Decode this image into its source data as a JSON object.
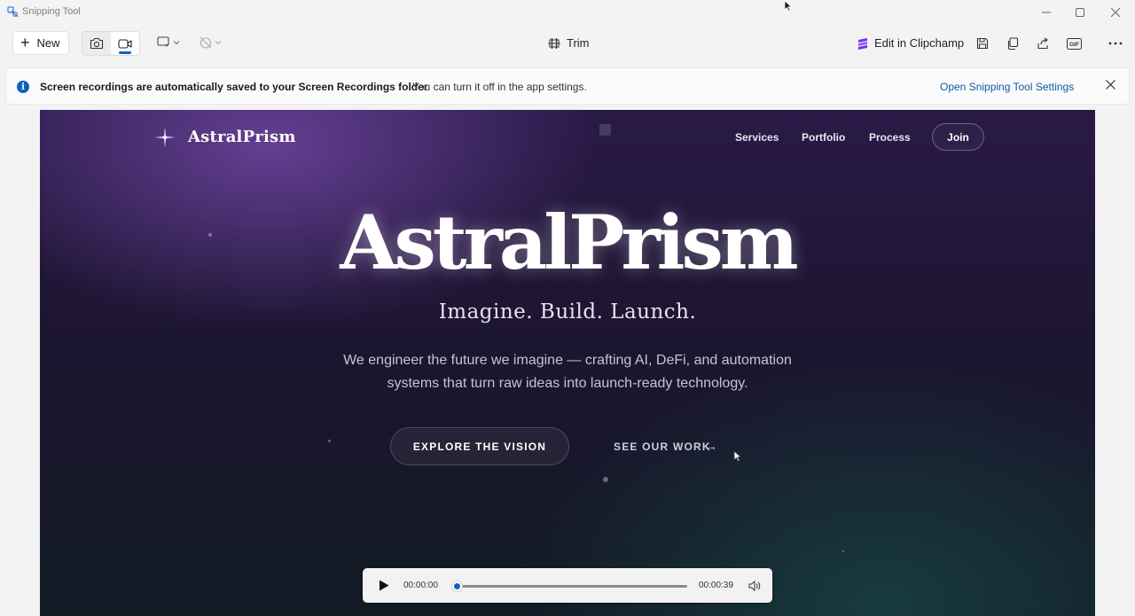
{
  "window": {
    "title": "Snipping Tool",
    "minimize_icon": "minimize-icon",
    "maximize_icon": "maximize-icon",
    "close_icon": "close-icon"
  },
  "toolbar": {
    "new_label": "New",
    "trim_label": "Trim",
    "clipchamp_label": "Edit in Clipchamp",
    "active_mode": "video"
  },
  "infobar": {
    "title": "Screen recordings are automatically saved to your Screen Recordings folder",
    "message": "You can turn it off in the app settings.",
    "link": "Open Snipping Tool Settings"
  },
  "site": {
    "logo": "AstralPrism",
    "nav": [
      "Services",
      "Portfolio",
      "Process"
    ],
    "join": "Join",
    "hero_title": "AstralPrism",
    "hero_subtitle": "Imagine. Build. Launch.",
    "hero_description": "We engineer the future we imagine — crafting AI, DeFi, and automation systems that turn raw ideas into launch-ready technology.",
    "cta_primary": "EXPLORE THE VISION",
    "cta_secondary": "SEE OUR WORK",
    "cta_arrow": "→"
  },
  "player": {
    "current_time": "00:00:00",
    "end_time": "00:00:39",
    "progress": 0.0
  },
  "colors": {
    "accent": "#0f62be",
    "link": "#0f5aa8"
  }
}
